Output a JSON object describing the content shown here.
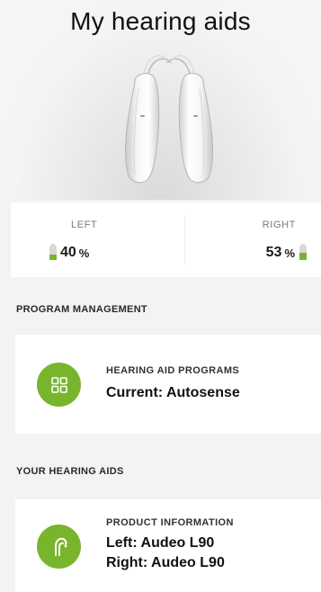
{
  "header": {
    "title": "My hearing aids"
  },
  "battery": {
    "left": {
      "label": "LEFT",
      "percent": 40,
      "percent_text": "40",
      "unit": "%"
    },
    "right": {
      "label": "RIGHT",
      "percent": 53,
      "percent_text": "53",
      "unit": "%"
    }
  },
  "program_management": {
    "section_title": "PROGRAM MANAGEMENT",
    "card": {
      "icon": "grid-icon",
      "title": "HEARING AID PROGRAMS",
      "current": "Current: Autosense"
    }
  },
  "your_hearing_aids": {
    "section_title": "YOUR HEARING AIDS",
    "card": {
      "icon": "hearing-aid-icon",
      "title": "PRODUCT INFORMATION",
      "left_model": "Left: Audeo L90",
      "right_model": "Right: Audeo L90"
    }
  },
  "colors": {
    "accent_green": "#78b52c",
    "battery_green": "#74b52d",
    "background": "#f3f3f3",
    "card": "#ffffff"
  }
}
